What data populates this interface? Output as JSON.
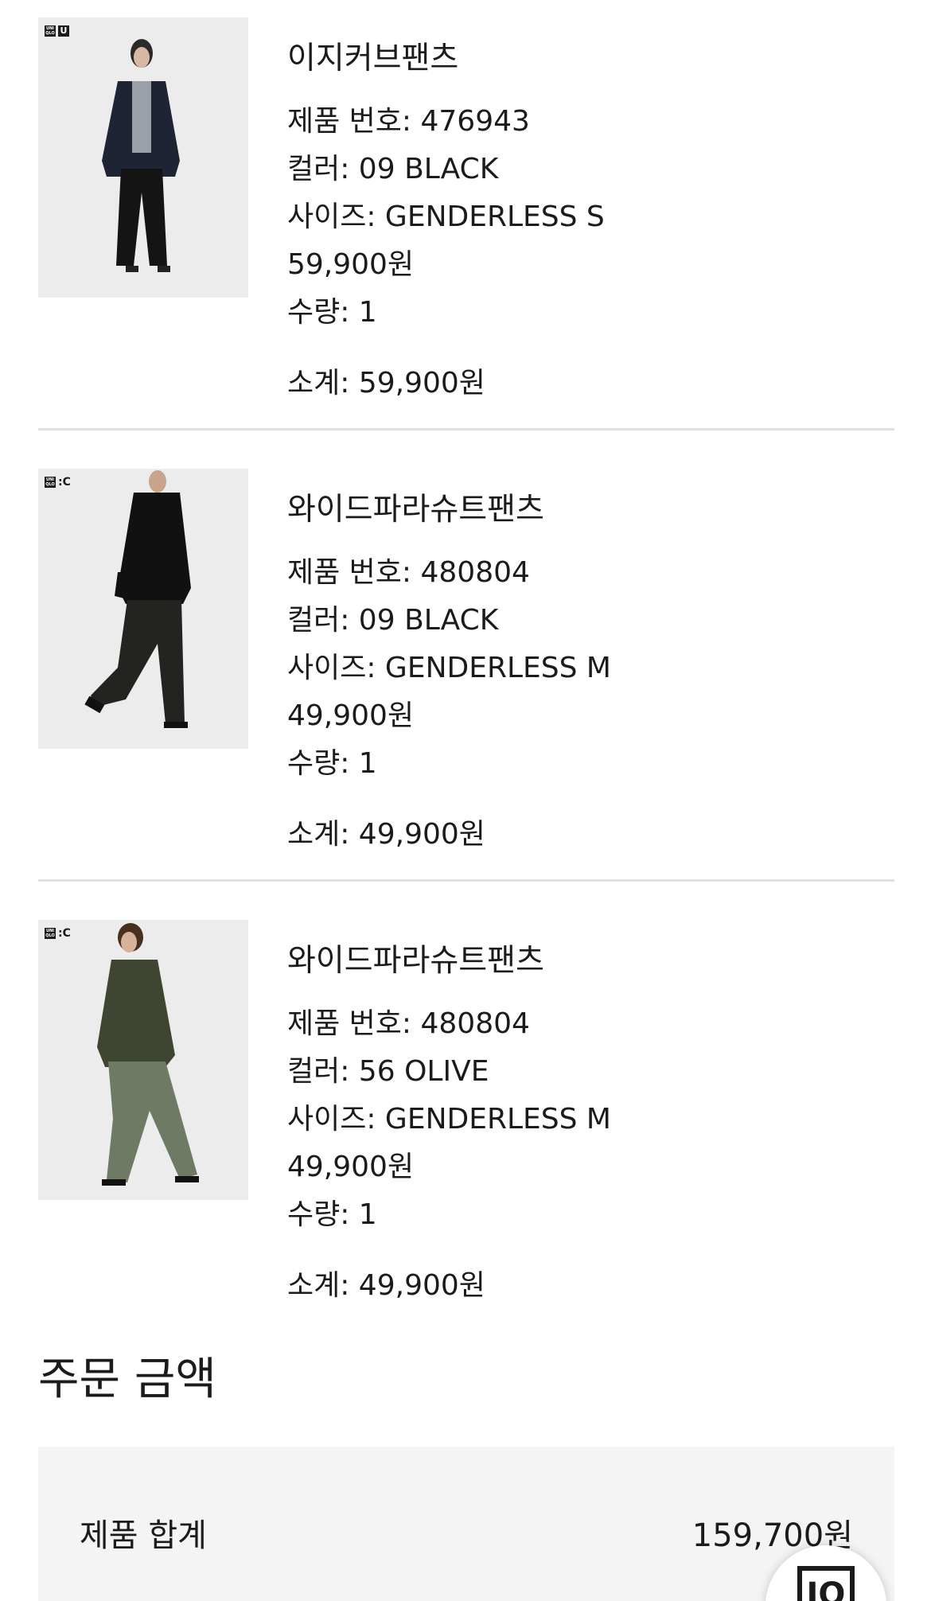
{
  "products": [
    {
      "brand_sub": "U",
      "name": "이지커브팬츠",
      "product_no": "제품 번호: 476943",
      "color": "컬러: 09 BLACK",
      "size": "사이즈: GENDERLESS S",
      "price": "59,900원",
      "qty": "수량: 1",
      "subtotal": "소계: 59,900원"
    },
    {
      "brand_sub": ":C",
      "name": "와이드파라슈트팬츠",
      "product_no": "제품 번호: 480804",
      "color": "컬러: 09 BLACK",
      "size": "사이즈: GENDERLESS M",
      "price": "49,900원",
      "qty": "수량: 1",
      "subtotal": "소계: 49,900원"
    },
    {
      "brand_sub": ":C",
      "name": "와이드파라슈트팬츠",
      "product_no": "제품 번호: 480804",
      "color": "컬러: 56 OLIVE",
      "size": "사이즈: GENDERLESS M",
      "price": "49,900원",
      "qty": "수량: 1",
      "subtotal": "소계: 49,900원"
    }
  ],
  "order_summary": {
    "title": "주문 금액",
    "product_total_label": "제품 합계",
    "product_total_value": "159,700원"
  },
  "logo_text": {
    "top": "UNI",
    "bottom": "QLO"
  },
  "chat_button_text": "IQ",
  "colors": {
    "text": "#1b1b1b",
    "divider": "#e0e0e0",
    "summary_bg": "#f4f4f4",
    "photo_bg": "#ececec"
  }
}
